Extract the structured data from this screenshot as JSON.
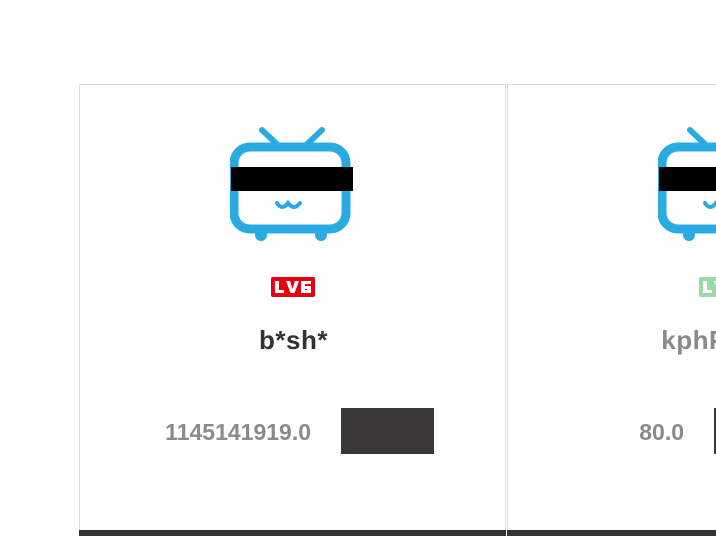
{
  "cards": [
    {
      "level": {
        "text": "LV6",
        "color": "#e60012"
      },
      "username": "b*sh*",
      "score": "1145141919.0"
    },
    {
      "level": {
        "text": "LV",
        "color": "#9bd9a8"
      },
      "username": "kphPXbw",
      "score": "80.0"
    }
  ],
  "avatar": {
    "icon": "bilibili-tv-icon",
    "color": "#29abe2",
    "censor_color": "#000000"
  },
  "colors": {
    "card_border": "#dcdcdc",
    "bottom_bar": "#333333",
    "button": "#3a3938",
    "primary_text": "#333333",
    "muted_text": "#8a8a8a"
  }
}
